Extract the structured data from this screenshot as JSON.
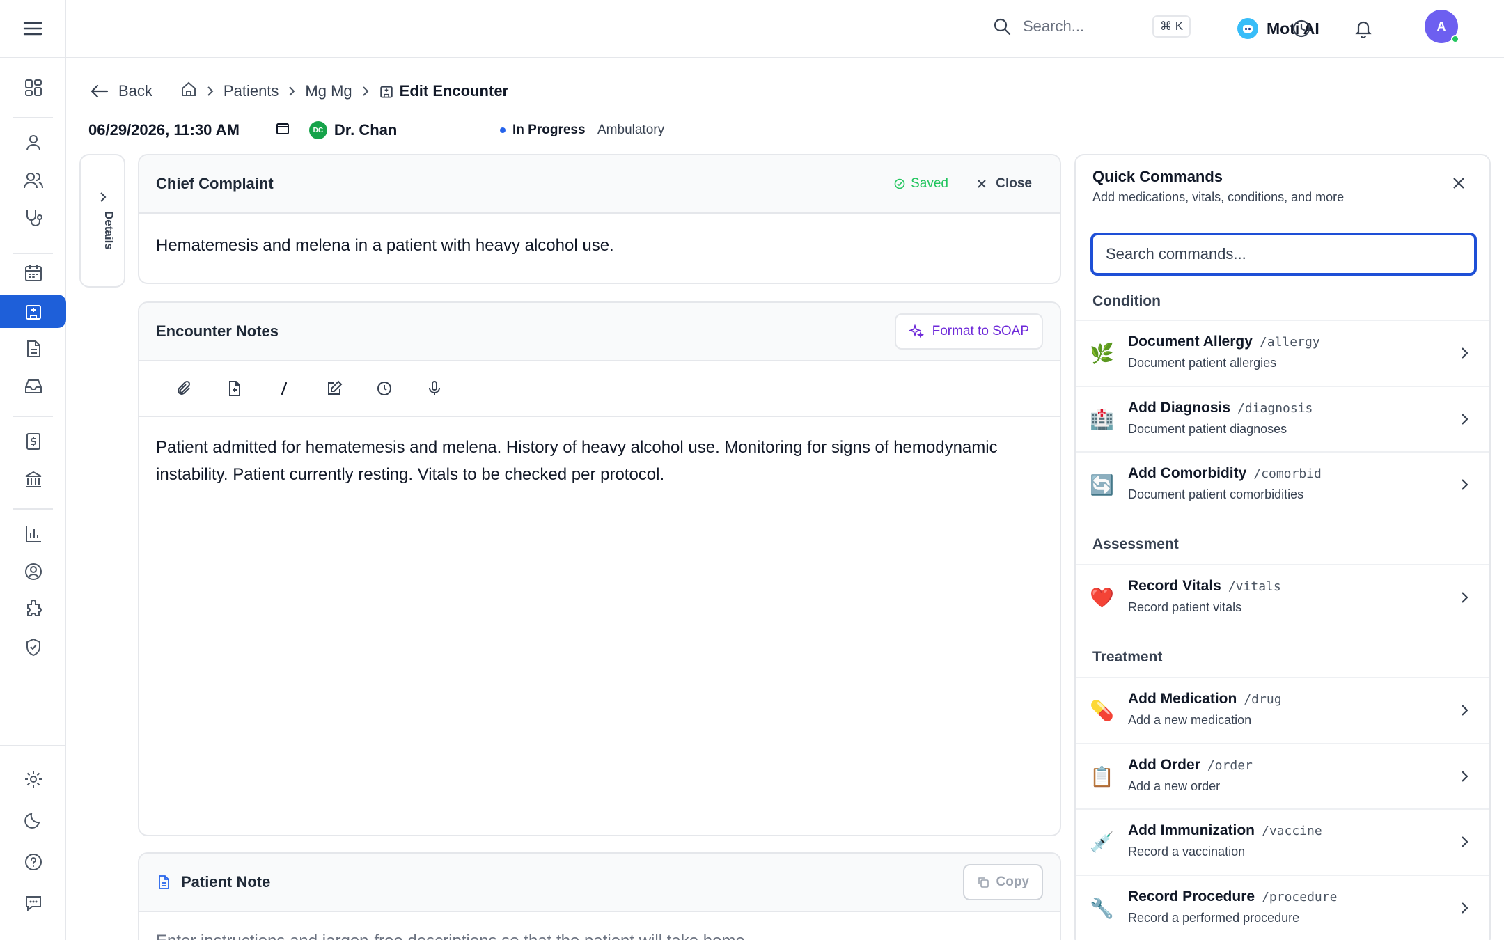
{
  "topbar": {
    "search_placeholder": "Search...",
    "shortcut": "⌘ K",
    "assistant_label": "Moti AI",
    "avatar_initial": "A"
  },
  "breadcrumb": {
    "back": "Back",
    "items": [
      "Patients",
      "Mg Mg"
    ],
    "current": "Edit Encounter"
  },
  "encounter": {
    "datetime": "06/29/2026, 11:30 AM",
    "provider_initials": "DC",
    "provider": "Dr. Chan",
    "status": "In Progress",
    "type": "Ambulatory"
  },
  "details_tab": "Details",
  "chief_complaint": {
    "title": "Chief Complaint",
    "saved": "Saved",
    "close": "Close",
    "text": "Hematemesis and melena in a patient with heavy alcohol use."
  },
  "encounter_notes": {
    "title": "Encounter Notes",
    "format_button": "Format to SOAP",
    "text": "Patient admitted for hematemesis and melena. History of heavy alcohol use. Monitoring for signs of hemodynamic instability. Patient currently resting. Vitals to be checked per protocol."
  },
  "patient_note": {
    "title": "Patient Note",
    "copy": "Copy",
    "text": "Enter instructions and jargon-free descriptions so that the patient will take home"
  },
  "quick_commands": {
    "title": "Quick Commands",
    "subtitle": "Add medications, vitals, conditions, and more",
    "search_placeholder": "Search commands...",
    "sections": [
      {
        "name": "Condition",
        "items": [
          {
            "emoji": "🌿",
            "name": "Document Allergy",
            "slash": "/allergy",
            "desc": "Document patient allergies"
          },
          {
            "emoji": "🏥",
            "name": "Add Diagnosis",
            "slash": "/diagnosis",
            "desc": "Document patient diagnoses"
          },
          {
            "emoji": "🔄",
            "name": "Add Comorbidity",
            "slash": "/comorbid",
            "desc": "Document patient comorbidities"
          }
        ]
      },
      {
        "name": "Assessment",
        "items": [
          {
            "emoji": "❤️",
            "name": "Record Vitals",
            "slash": "/vitals",
            "desc": "Record patient vitals"
          }
        ]
      },
      {
        "name": "Treatment",
        "items": [
          {
            "emoji": "💊",
            "name": "Add Medication",
            "slash": "/drug",
            "desc": "Add a new medication"
          },
          {
            "emoji": "📋",
            "name": "Add Order",
            "slash": "/order",
            "desc": "Add a new order"
          },
          {
            "emoji": "💉",
            "name": "Add Immunization",
            "slash": "/vaccine",
            "desc": "Record a vaccination"
          },
          {
            "emoji": "🔧",
            "name": "Record Procedure",
            "slash": "/procedure",
            "desc": "Record a performed procedure"
          }
        ]
      }
    ]
  },
  "colors": {
    "accent": "#1e5fd9",
    "saved": "#22c55e",
    "soap": "#6d28d9",
    "status_dot": "#2563eb"
  }
}
